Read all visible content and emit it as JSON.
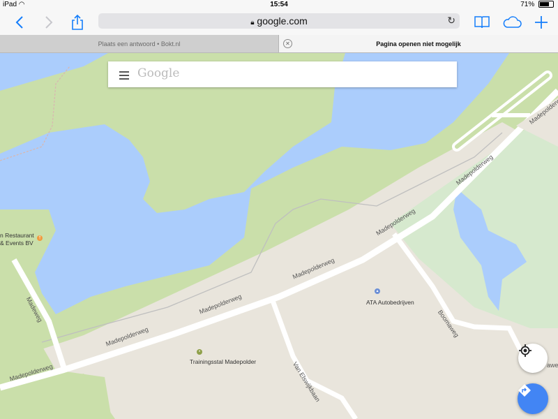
{
  "status": {
    "device": "iPad",
    "time": "15:54",
    "battery": "71%",
    "battery_level": 0.71
  },
  "browser": {
    "url": "google.com",
    "icons": [
      "back-icon",
      "forward-icon",
      "share-icon",
      "bookmarks-icon",
      "cloud-tabs-icon",
      "new-tab-icon",
      "reload-icon",
      "lock-icon"
    ]
  },
  "tabs": [
    {
      "title": "Plaats een antwoord • Bokt.nl",
      "active": false
    },
    {
      "title": "Pagina openen niet mogelijk",
      "active": true
    }
  ],
  "search": {
    "logo": "Google"
  },
  "map": {
    "colors": {
      "water": "#abcdfc",
      "park": "#cadfaa",
      "land": "#e9e5dc",
      "road": "#ffffff",
      "light_park": "#d6e9ce"
    },
    "places": [
      {
        "line1": "n Restaurant",
        "line2": "& Events BV"
      },
      {
        "name": "ATA Autobedrijven"
      },
      {
        "name": "Trainingsstal Madepolder"
      }
    ],
    "streets": {
      "madepolderweg": "Madepolderweg",
      "madeweg": "Madeweg",
      "boomaweg": "Boomaweg",
      "van_elswijkbaan": "Van Elswijkbaan",
      "awe": "awe"
    }
  }
}
